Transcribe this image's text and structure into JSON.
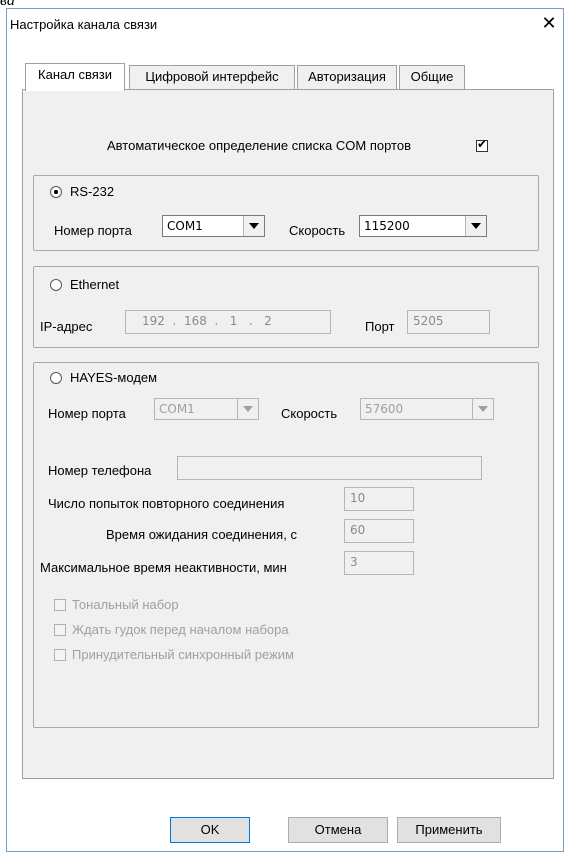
{
  "fragment_text": "ва",
  "window": {
    "title": "Настройка канала связи",
    "close_symbol": "✕"
  },
  "tabs": [
    {
      "label": "Канал связи"
    },
    {
      "label": "Цифровой интерфейс"
    },
    {
      "label": "Авторизация"
    },
    {
      "label": "Общие"
    }
  ],
  "auto_detect": {
    "label": "Автоматическое определение списка COM портов",
    "checked": true
  },
  "rs232": {
    "label": "RS-232",
    "selected": true,
    "port_label": "Номер порта",
    "port_value": "COM1",
    "speed_label": "Скорость",
    "speed_value": "115200"
  },
  "ethernet": {
    "label": "Ethernet",
    "selected": false,
    "ip_label": "IP-адрес",
    "ip_value": "192  .  168  .   1   .   2",
    "port_label": "Порт",
    "port_value": "5205"
  },
  "hayes": {
    "label": "HAYES-модем",
    "selected": false,
    "port_label": "Номер порта",
    "port_value": "COM1",
    "speed_label": "Скорость",
    "speed_value": "57600",
    "phone_label": "Номер телефона",
    "phone_value": "",
    "retries_label": "Число попыток повторного соединения",
    "retries_value": "10",
    "timeout_label": "Время ожидания соединения, с",
    "timeout_value": "60",
    "inactivity_label": "Максимальное время неактивности, мин",
    "inactivity_value": "3",
    "tone_dial_label": "Тональный набор",
    "wait_tone_label": "Ждать гудок перед началом набора",
    "forced_sync_label": "Принудительный синхронный режим"
  },
  "buttons": {
    "ok": "OK",
    "cancel": "Отмена",
    "apply": "Применить"
  },
  "colors": {
    "dialog_border": "#7a9ac7",
    "panel_bg": "#f0f0f0",
    "disabled_text": "#a0a0a0",
    "default_button_border": "#0078d7"
  }
}
